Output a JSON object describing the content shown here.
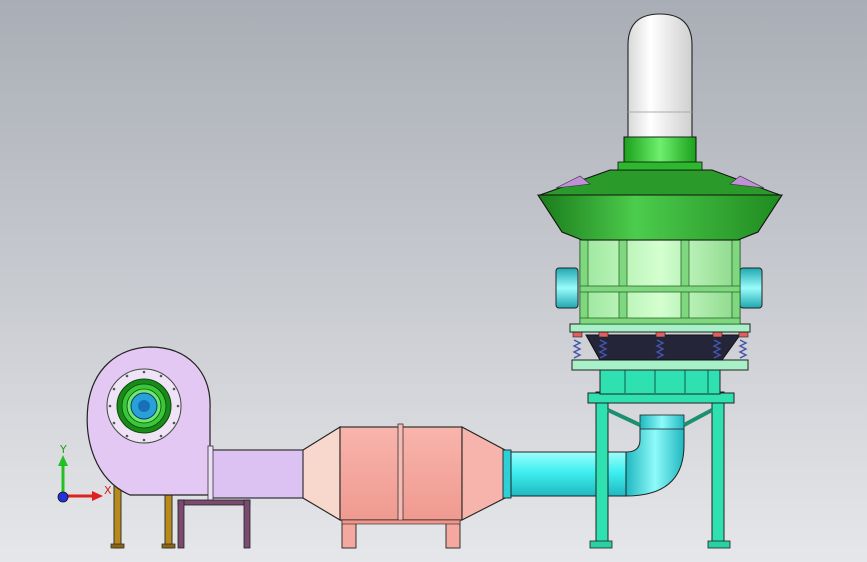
{
  "scene": {
    "description_tag": "cad-assembly-view",
    "background_top": "#a9adb5",
    "background_bottom": "#e6e7ea"
  },
  "triad": {
    "x_label": "X",
    "y_label": "Y",
    "x_color": "#e02020",
    "y_color": "#22c022",
    "z_color": "#2233dd"
  },
  "colors": {
    "fan_body": "#e2c8f2",
    "fan_motor_ring_outer": "#1a8a1a",
    "fan_motor_ring_mid": "#38c838",
    "fan_motor_core": "#2aa0d8",
    "duct_lavender": "#dcc2f2",
    "stand_brown": "#b88a1a",
    "stand_purple": "#7a4a70",
    "filter_transition": "#f8d8cc",
    "filter_box": "#f4a8a0",
    "pipe_cyan": "#3ff0f0",
    "tower_frame": "#2fe0b0",
    "tower_base_plate": "#a8f0c8",
    "spring_color": "#4455aa",
    "tower_cone_dark": "#25253a",
    "tower_window_frame": "#7fd87f",
    "tower_window_fill": "#b8f0a8",
    "tower_cone_green": "#2a9a2a",
    "tower_hood_green": "#38c038",
    "tower_chimney_white": "#f6f6f6",
    "side_cylinder_cyan": "#3ce0e0"
  }
}
